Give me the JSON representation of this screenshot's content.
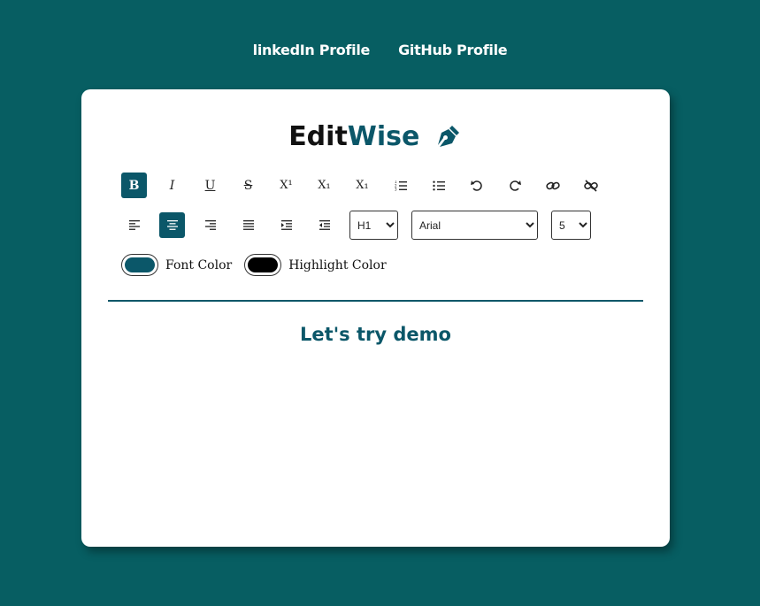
{
  "nav": {
    "linkedin_label": "linkedIn Profile",
    "github_label": "GitHub Profile"
  },
  "brand": {
    "part1": "Edit",
    "part2": "Wise",
    "icon": "pen-nib-icon"
  },
  "toolbar": {
    "row1": [
      {
        "name": "bold-button",
        "icon": "bold-icon",
        "glyph": "B",
        "active": true
      },
      {
        "name": "italic-button",
        "icon": "italic-icon",
        "glyph": "I",
        "active": false
      },
      {
        "name": "underline-button",
        "icon": "underline-icon",
        "glyph": "U",
        "active": false
      },
      {
        "name": "strikethrough-button",
        "icon": "strikethrough-icon",
        "glyph": "S",
        "active": false
      },
      {
        "name": "superscript-button",
        "icon": "superscript-icon",
        "glyph": "X¹",
        "active": false
      },
      {
        "name": "subscript-button",
        "icon": "subscript-icon",
        "glyph": "X₁",
        "active": false
      },
      {
        "name": "subscript-alt-button",
        "icon": "subscript-icon",
        "glyph": "X₁",
        "active": false
      },
      {
        "name": "ordered-list-button",
        "icon": "ordered-list-icon",
        "active": false
      },
      {
        "name": "unordered-list-button",
        "icon": "unordered-list-icon",
        "active": false
      },
      {
        "name": "undo-button",
        "icon": "undo-icon",
        "active": false
      },
      {
        "name": "redo-button",
        "icon": "redo-icon",
        "active": false
      },
      {
        "name": "link-button",
        "icon": "link-icon",
        "active": false
      },
      {
        "name": "unlink-button",
        "icon": "unlink-icon",
        "active": false
      }
    ],
    "row2": [
      {
        "name": "align-left-button",
        "icon": "align-left-icon",
        "active": false
      },
      {
        "name": "align-center-button",
        "icon": "align-center-icon",
        "active": true
      },
      {
        "name": "align-right-button",
        "icon": "align-right-icon",
        "active": false
      },
      {
        "name": "justify-button",
        "icon": "justify-icon",
        "active": false
      },
      {
        "name": "indent-button",
        "icon": "indent-icon",
        "active": false
      },
      {
        "name": "outdent-button",
        "icon": "outdent-icon",
        "active": false
      }
    ],
    "heading_select": {
      "selected": "H1"
    },
    "font_select": {
      "selected": "Arial"
    },
    "size_select": {
      "selected": "5"
    }
  },
  "colors": {
    "font_color_label": "Font Color",
    "font_color_value": "#0b5769",
    "highlight_color_label": "Highlight Color",
    "highlight_color_value": "#000000"
  },
  "editor": {
    "heading": "Let's try demo"
  },
  "theme": {
    "background": "#075e62",
    "accent": "#0b5769"
  }
}
